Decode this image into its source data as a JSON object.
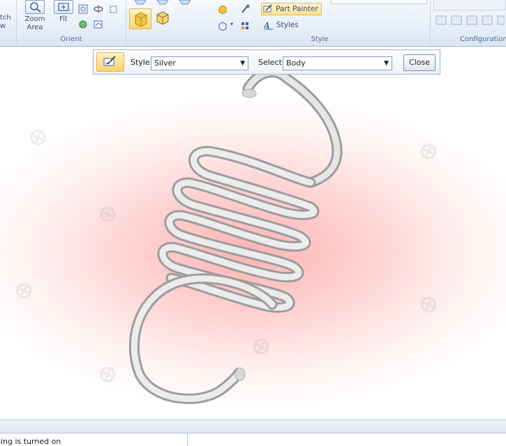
{
  "ribbon": {
    "partial_left_label_1": "tch",
    "partial_left_label_2": "w",
    "zoom_area_label_1": "Zoom",
    "zoom_area_label_2": "Area",
    "fit_label": "Fit",
    "orient_group": "Orient",
    "part_painter_label": "Part Painter",
    "styles_label": "Styles",
    "style_group": "Style",
    "configuration_group": "Configuration"
  },
  "command_bar": {
    "style_label": "Style:",
    "style_value": "Silver",
    "select_label": "Select:",
    "select_value": "Body",
    "close_label": "Close"
  },
  "status": {
    "text": "ping is turned on"
  },
  "icons": [
    "zoom-area-icon",
    "fit-icon",
    "orient-icons",
    "shaded-view-icon",
    "part-painter-icon",
    "styles-icon",
    "dropdown-arrow-icon"
  ],
  "colors": {
    "ribbon_bg": "#e6eef8",
    "viewport_glow": "#ffb3b3",
    "highlight_button": "#ffe08a",
    "spring": "#d9d9d9"
  }
}
